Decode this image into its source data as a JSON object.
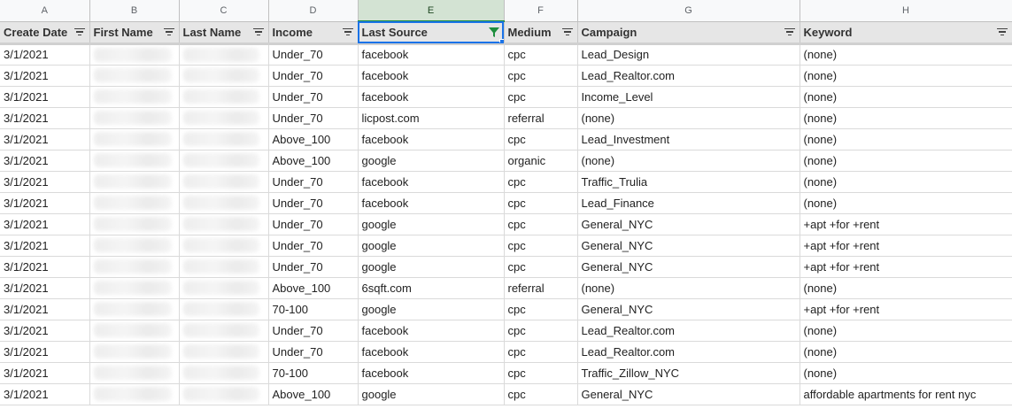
{
  "columns": [
    "A",
    "B",
    "C",
    "D",
    "E",
    "F",
    "G",
    "H"
  ],
  "headers": [
    "Create Date",
    "First Name",
    "Last Name",
    "Income",
    "Last Source",
    "Medium",
    "Campaign",
    "Keyword"
  ],
  "active_filter_column": "E",
  "rows": [
    [
      "3/1/2021",
      "",
      "",
      "Under_70",
      "facebook",
      "cpc",
      "Lead_Design",
      "(none)"
    ],
    [
      "3/1/2021",
      "",
      "",
      "Under_70",
      "facebook",
      "cpc",
      "Lead_Realtor.com",
      "(none)"
    ],
    [
      "3/1/2021",
      "",
      "",
      "Under_70",
      "facebook",
      "cpc",
      "Income_Level",
      "(none)"
    ],
    [
      "3/1/2021",
      "",
      "",
      "Under_70",
      "licpost.com",
      "referral",
      "(none)",
      "(none)"
    ],
    [
      "3/1/2021",
      "",
      "",
      "Above_100",
      "facebook",
      "cpc",
      "Lead_Investment",
      "(none)"
    ],
    [
      "3/1/2021",
      "",
      "",
      "Above_100",
      "google",
      "organic",
      "(none)",
      "(none)"
    ],
    [
      "3/1/2021",
      "",
      "",
      "Under_70",
      "facebook",
      "cpc",
      "Traffic_Trulia",
      "(none)"
    ],
    [
      "3/1/2021",
      "",
      "",
      "Under_70",
      "facebook",
      "cpc",
      "Lead_Finance",
      "(none)"
    ],
    [
      "3/1/2021",
      "",
      "",
      "Under_70",
      "google",
      "cpc",
      "General_NYC",
      "+apt +for +rent"
    ],
    [
      "3/1/2021",
      "",
      "",
      "Under_70",
      "google",
      "cpc",
      "General_NYC",
      "+apt +for +rent"
    ],
    [
      "3/1/2021",
      "",
      "",
      "Under_70",
      "google",
      "cpc",
      "General_NYC",
      "+apt +for +rent"
    ],
    [
      "3/1/2021",
      "",
      "",
      "Above_100",
      "6sqft.com",
      "referral",
      "(none)",
      "(none)"
    ],
    [
      "3/1/2021",
      "",
      "",
      "70-100",
      "google",
      "cpc",
      "General_NYC",
      "+apt +for +rent"
    ],
    [
      "3/1/2021",
      "",
      "",
      "Under_70",
      "facebook",
      "cpc",
      "Lead_Realtor.com",
      "(none)"
    ],
    [
      "3/1/2021",
      "",
      "",
      "Under_70",
      "facebook",
      "cpc",
      "Lead_Realtor.com",
      "(none)"
    ],
    [
      "3/1/2021",
      "",
      "",
      "70-100",
      "facebook",
      "cpc",
      "Traffic_Zillow_NYC",
      "(none)"
    ],
    [
      "3/1/2021",
      "",
      "",
      "Above_100",
      "google",
      "cpc",
      "General_NYC",
      "affordable apartments for rent nyc"
    ]
  ],
  "colors": {
    "accent": "#1a73e8",
    "active_column_header": "#d3e3d3",
    "active_filter_icon": "#1e8e3e"
  }
}
